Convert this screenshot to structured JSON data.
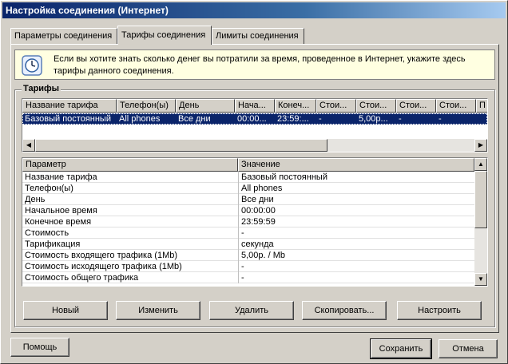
{
  "window": {
    "title": "Настройка соединения (Интернет)"
  },
  "tabs": [
    {
      "label": "Параметры соединения"
    },
    {
      "label": "Тарифы соединения"
    },
    {
      "label": "Лимиты соединения"
    }
  ],
  "info": {
    "icon": "clock-icon",
    "text": "Если вы хотите знать сколько денег вы потратили за время, проведенное в Интернет, укажите здесь тарифы данного соединения."
  },
  "tariffs": {
    "group_title": "Тарифы",
    "columns": [
      "Название тарифа",
      "Телефон(ы)",
      "День",
      "Нача...",
      "Конеч...",
      "Стои...",
      "Стои...",
      "Стои...",
      "Стои...",
      "П"
    ],
    "rows": [
      {
        "cells": [
          "Базовый постоянный",
          "All phones",
          "Все дни",
          "00:00...",
          "23:59:...",
          "-",
          "5,00р...",
          "-",
          "-",
          ""
        ],
        "selected": true
      }
    ]
  },
  "properties": {
    "header": {
      "param": "Параметр",
      "value": "Значение"
    },
    "rows": [
      {
        "param": "Название тарифа",
        "value": "Базовый постоянный"
      },
      {
        "param": "Телефон(ы)",
        "value": "All phones"
      },
      {
        "param": "День",
        "value": "Все дни"
      },
      {
        "param": "Начальное время",
        "value": "00:00:00"
      },
      {
        "param": "Конечное время",
        "value": "23:59:59"
      },
      {
        "param": "Стоимость",
        "value": "-"
      },
      {
        "param": "Тарификация",
        "value": "секунда"
      },
      {
        "param": "Стоимость входящего трафика (1Mb)",
        "value": "5,00р. / Mb"
      },
      {
        "param": "Стоимость исходящего трафика (1Mb)",
        "value": "-"
      },
      {
        "param": "Стоимость общего трафика",
        "value": "-"
      }
    ]
  },
  "actions": {
    "new": "Новый",
    "edit": "Изменить",
    "delete": "Удалить",
    "copy": "Скопировать...",
    "configure": "Настроить"
  },
  "footer": {
    "help": "Помощь",
    "save": "Сохранить",
    "cancel": "Отмена"
  }
}
